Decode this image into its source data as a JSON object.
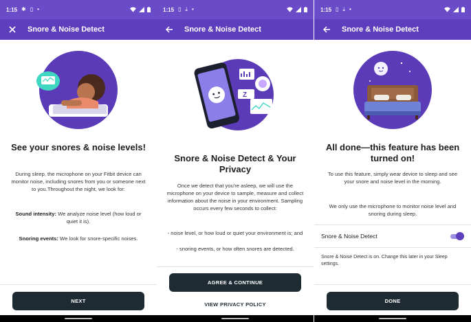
{
  "status_bar": {
    "time": "1:15"
  },
  "colors": {
    "status_bar": "#6a4bc8",
    "app_bar": "#5d3fbd",
    "button": "#1f2b33",
    "toggle": "#5d3fbd"
  },
  "screen1": {
    "nav_icon": "close-icon",
    "title": "Snore & Noise Detect",
    "heading": "See your snores & noise levels!",
    "intro": "During sleep, the microphone on your Fitbit device can monitor noise, including snores from you or someone next to you.Throughout the night, we look for:",
    "sound_label": "Sound intensity:",
    "sound_text": " We analyze noise level (how loud or quiet it is).",
    "snore_label": "Snoring events:",
    "snore_text": " We look for snore-specific noises.",
    "button": "NEXT"
  },
  "screen2": {
    "nav_icon": "back-arrow-icon",
    "title": "Snore & Noise Detect",
    "heading": "Snore & Noise Detect & Your Privacy",
    "intro": "Once we detect that you're asleep, we will use the microphone on your device to sample, measure and collect information about the noise in your environment. Sampling occurs every few seconds to collect:",
    "bullet1": "- noise level, or how loud or quiet your environment is; and",
    "bullet2": "- snoring events, or how often snores are detected.",
    "primary_button": "AGREE & CONTINUE",
    "secondary_button": "VIEW PRIVACY POLICY"
  },
  "screen3": {
    "nav_icon": "back-arrow-icon",
    "title": "Snore & Noise Detect",
    "heading": "All done—this feature has been turned on!",
    "para1": "To use this feature, simply wear device to sleep and see your snore and noise level in the morning.",
    "para2": "We only use the microphone to monitor noise level and snoring during sleep.",
    "setting_label": "Snore & Noise Detect",
    "setting_on": true,
    "note": "Snore & Noise Detect is on. Change this later in your Sleep settings.",
    "button": "DONE"
  }
}
